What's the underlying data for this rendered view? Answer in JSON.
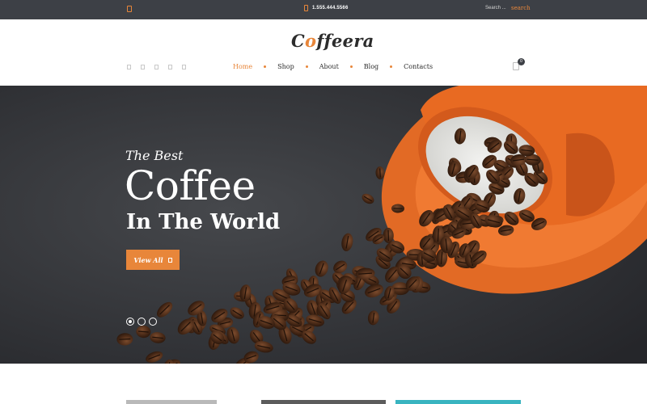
{
  "topbar": {
    "location_icon": "map-marker-icon",
    "phone_icon": "phone-icon",
    "phone": "1.555.444.5566",
    "search_placeholder": "Search ...",
    "search_button": "search"
  },
  "header": {
    "logo": {
      "prefix": "C",
      "bean": "o",
      "suffix": "ffeera"
    },
    "social_icons": [
      "facebook-icon",
      "twitter-icon",
      "google-plus-icon",
      "instagram-icon",
      "pinterest-icon"
    ],
    "nav": [
      {
        "label": "Home",
        "active": true
      },
      {
        "label": "Shop",
        "active": false
      },
      {
        "label": "About",
        "active": false
      },
      {
        "label": "Blog",
        "active": false
      },
      {
        "label": "Contacts",
        "active": false
      }
    ],
    "cart_count": "0"
  },
  "hero": {
    "subtitle": "The Best",
    "title": "Coffee",
    "title_line2": "In The World",
    "button_label": "View All",
    "button_icon": "arrow-right-icon",
    "slides": 3,
    "active_slide": 1
  },
  "colors": {
    "accent": "#e8863a",
    "topbar": "#3d4046",
    "hero_bg": "#2f3033",
    "teal": "#39b4c0"
  }
}
